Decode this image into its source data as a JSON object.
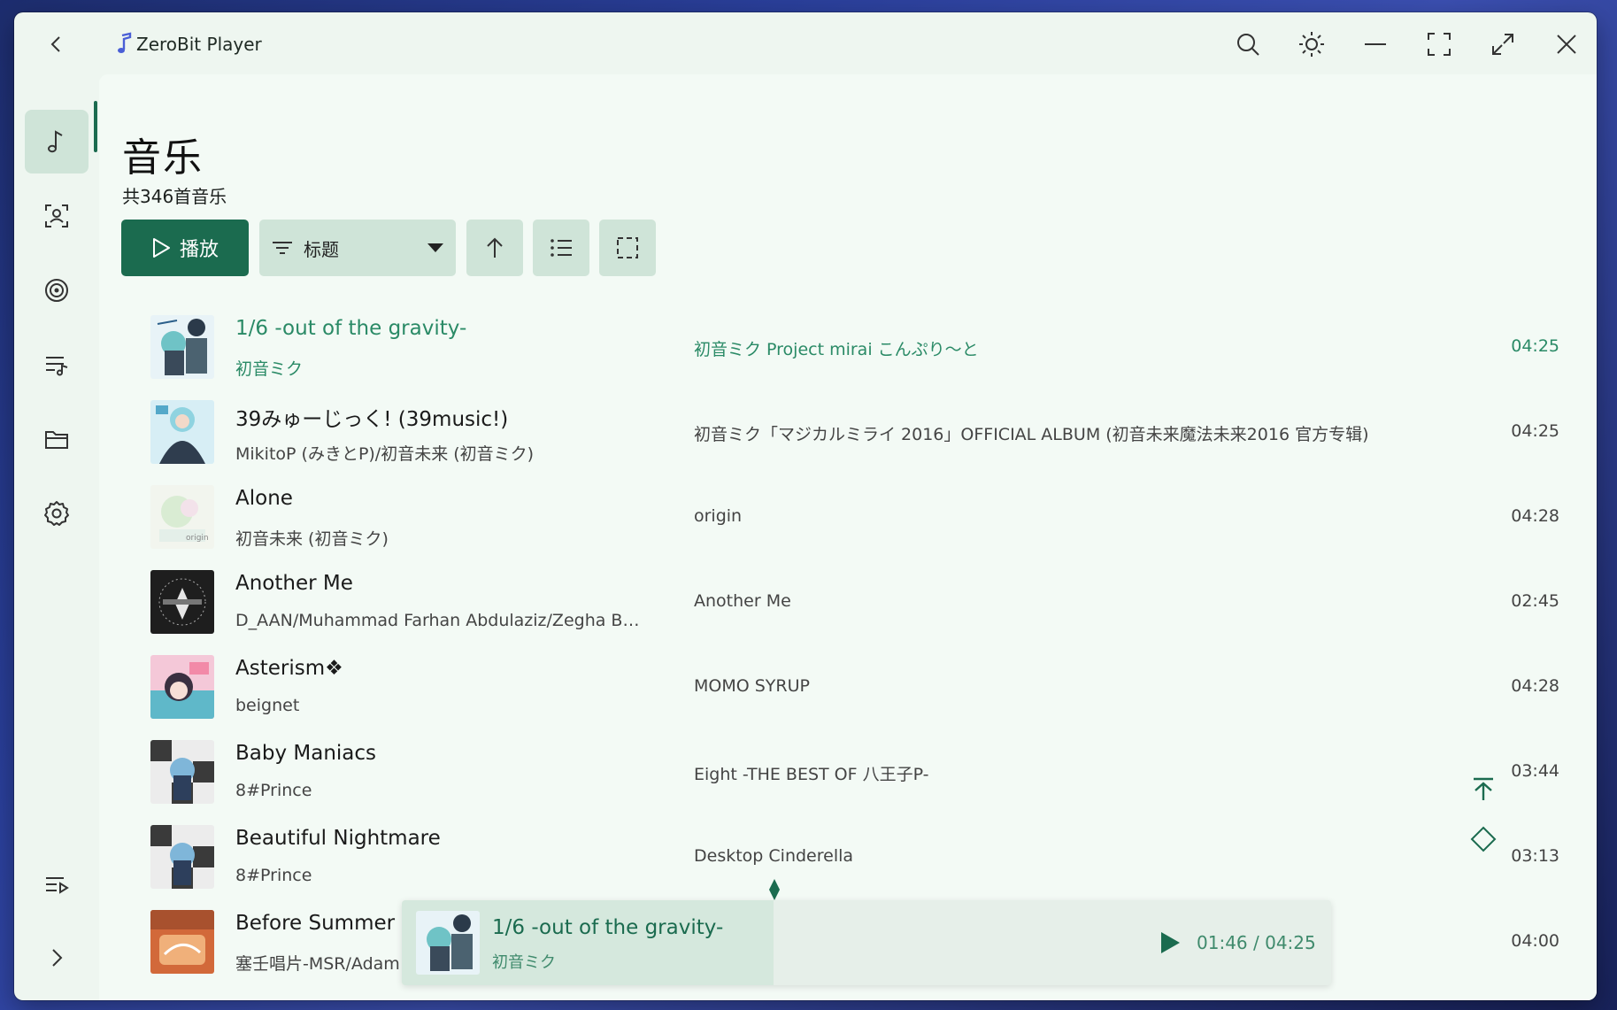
{
  "app": {
    "title": "ZeroBit Player",
    "titlebar_icons": [
      "back-icon",
      "search-icon",
      "theme-icon",
      "minimize-icon",
      "fullscreen-icon",
      "maximize-icon",
      "close-icon"
    ]
  },
  "sidebar": {
    "items": [
      {
        "name": "music",
        "icon": "music-note-icon",
        "active": true
      },
      {
        "name": "artists",
        "icon": "artist-icon",
        "active": false
      },
      {
        "name": "albums",
        "icon": "album-icon",
        "active": false
      },
      {
        "name": "playlists",
        "icon": "playlist-icon",
        "active": false
      },
      {
        "name": "folders",
        "icon": "folder-icon",
        "active": false
      },
      {
        "name": "settings",
        "icon": "gear-icon",
        "active": false
      }
    ],
    "bottom": [
      {
        "name": "play-queue",
        "icon": "queue-icon"
      },
      {
        "name": "expand",
        "icon": "chevron-right-icon"
      }
    ]
  },
  "page": {
    "title": "音乐",
    "count_text": "共346首音乐"
  },
  "toolbar": {
    "play_label": "播放",
    "sort_label": "标题"
  },
  "songs": [
    {
      "title": "1/6 -out of the gravity-",
      "artist": "初音ミク",
      "album": "初音ミク Project mirai こんぷり～と",
      "duration": "04:25",
      "playing": true
    },
    {
      "title": "39みゅーじっく! (39music!)",
      "artist": "MikitoP (みきとP)/初音未来 (初音ミク)",
      "album": "初音ミク「マジカルミライ 2016」OFFICIAL ALBUM (初音未来魔法未来2016 官方专辑)",
      "duration": "04:25",
      "playing": false
    },
    {
      "title": "Alone",
      "artist": "初音未来 (初音ミク)",
      "album": "origin",
      "duration": "04:28",
      "playing": false
    },
    {
      "title": "Another Me",
      "artist": "D_AAN/Muhammad Farhan Abdulaziz/Zegha Br…",
      "album": "Another Me",
      "duration": "02:45",
      "playing": false
    },
    {
      "title": "Asterism❖",
      "artist": "beignet",
      "album": "MOMO SYRUP",
      "duration": "04:28",
      "playing": false
    },
    {
      "title": "Baby Maniacs",
      "artist": "8#Prince",
      "album": "Eight -THE BEST OF 八王子P-",
      "duration": "03:44",
      "playing": false
    },
    {
      "title": "Beautiful Nightmare",
      "artist": "8#Prince",
      "album": "Desktop Cinderella",
      "duration": "03:13",
      "playing": false
    },
    {
      "title": "Before Summer",
      "artist": "塞壬唱片-MSR/Adam",
      "album": "",
      "duration": "04:00",
      "playing": false
    }
  ],
  "now_playing": {
    "title": "1/6 -out of the gravity-",
    "artist": "初音ミク",
    "time": "01:46 / 04:25",
    "progress": 0.4
  },
  "colors": {
    "accent": "#1b6b4f",
    "accent_light": "#cfe4d8",
    "playing_text": "#2a8a66",
    "background": "#f3faf5"
  }
}
